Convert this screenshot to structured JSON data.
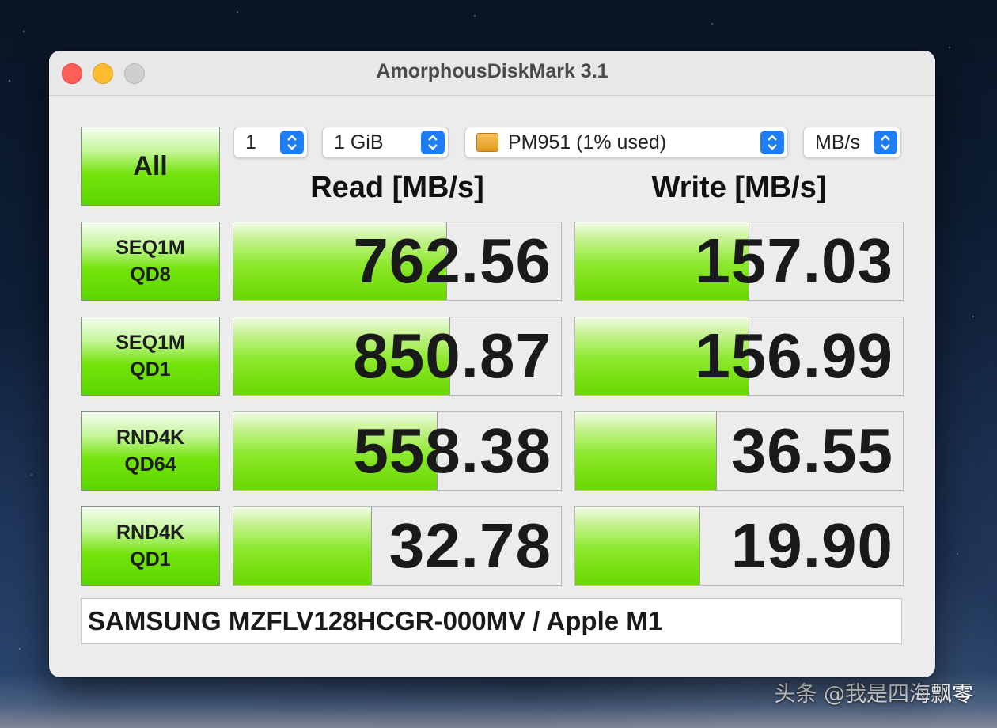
{
  "app": {
    "title": "AmorphousDiskMark 3.1"
  },
  "controls": {
    "all_label": "All",
    "count_value": "1",
    "size_value": "1 GiB",
    "disk_value": "PM951 (1% used)",
    "unit_value": "MB/s"
  },
  "columns": {
    "read": "Read [MB/s]",
    "write": "Write [MB/s]"
  },
  "tests": [
    {
      "line1": "SEQ1M",
      "line2": "QD8",
      "read": "762.56",
      "write": "157.03",
      "read_fill": 0.65,
      "write_fill": 0.53
    },
    {
      "line1": "SEQ1M",
      "line2": "QD1",
      "read": "850.87",
      "write": "156.99",
      "read_fill": 0.66,
      "write_fill": 0.53
    },
    {
      "line1": "RND4K",
      "line2": "QD64",
      "read": "558.38",
      "write": "36.55",
      "read_fill": 0.62,
      "write_fill": 0.43
    },
    {
      "line1": "RND4K",
      "line2": "QD1",
      "read": "32.78",
      "write": "19.90",
      "read_fill": 0.42,
      "write_fill": 0.38
    }
  ],
  "footer": {
    "device": "SAMSUNG MZFLV128HCGR-000MV / Apple M1"
  },
  "watermark": "头条 @我是四海飘零",
  "colors": {
    "accent_green": "#6ad800",
    "select_blue": "#1d7ef5"
  }
}
